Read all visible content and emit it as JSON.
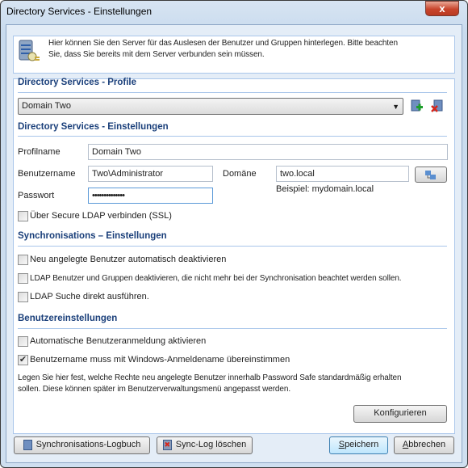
{
  "window": {
    "title": "Directory Services - Einstellungen",
    "close_label": "x"
  },
  "info": {
    "text_line1": "Hier können Sie den Server für das Auslesen der Benutzer und Gruppen hinterlegen. Bitte beachten",
    "text_line2": "Sie, dass Sie bereits mit dem Server verbunden sein müssen.",
    "icon": "server-plug-icon"
  },
  "profile": {
    "heading": "Directory Services - Profile",
    "selected": "Domain Two",
    "add_icon": "add-profile-icon",
    "delete_icon": "delete-profile-icon"
  },
  "settings": {
    "heading": "Directory Services - Einstellungen",
    "profilname_label": "Profilname",
    "profilname_value": "Domain Two",
    "benutzername_label": "Benutzername",
    "benutzername_value": "Two\\Administrator",
    "domaene_label": "Domäne",
    "domaene_value": "two.local",
    "passwort_label": "Passwort",
    "passwort_value": "••••••••••••••",
    "beispiel": "Beispiel: mydomain.local",
    "ssl_label": "Über Secure LDAP verbinden (SSL)",
    "ssl_checked": false
  },
  "sync": {
    "heading": "Synchronisations – Einstellungen",
    "options": [
      {
        "label": "Neu angelegte Benutzer automatisch deaktivieren",
        "checked": false
      },
      {
        "label": "LDAP Benutzer und Gruppen deaktivieren, die nicht mehr bei der Synchronisation beachtet werden sollen.",
        "checked": false
      },
      {
        "label": "LDAP Suche direkt ausführen.",
        "checked": false
      }
    ]
  },
  "user": {
    "heading": "Benutzereinstellungen",
    "options": [
      {
        "label": "Automatische Benutzeranmeldung aktivieren",
        "checked": false
      },
      {
        "label": "Benutzername muss mit Windows-Anmeldename übereinstimmen",
        "checked": true
      }
    ],
    "text_line1": "Legen Sie hier fest, welche Rechte neu angelegte Benutzer innerhalb Password Safe standardmäßig erhalten",
    "text_line2": "sollen. Diese können später im Benutzerverwaltungsmenü angepasst werden.",
    "configure_label": "Konfigurieren"
  },
  "footer": {
    "sync_log": "Synchronisations-Logbuch",
    "sync_log_delete": "Sync-Log löschen",
    "save_first": "S",
    "save_rest": "peichern",
    "cancel_first": "A",
    "cancel_rest": "bbrechen"
  }
}
